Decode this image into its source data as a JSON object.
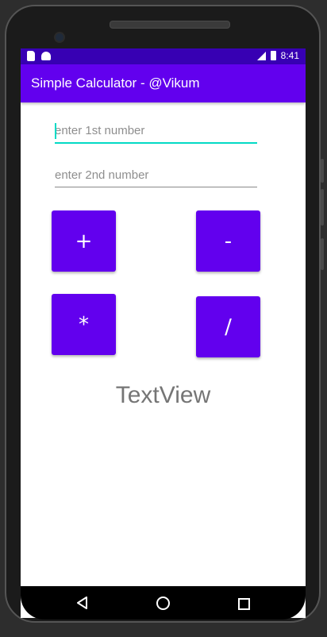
{
  "status_bar": {
    "time": "8:41",
    "icons": [
      "sd-card-icon",
      "android-icon",
      "signal-icon",
      "battery-icon"
    ]
  },
  "app_bar": {
    "title": "Simple Calculator - @Vikum"
  },
  "inputs": {
    "first": {
      "value": "",
      "placeholder": "enter 1st number"
    },
    "second": {
      "value": "",
      "placeholder": "enter 2nd number"
    }
  },
  "buttons": {
    "add": "+",
    "subtract": "-",
    "multiply": "*",
    "divide": "/"
  },
  "result": {
    "text": "TextView"
  },
  "nav_bar": {
    "icons": [
      "back-icon",
      "home-icon",
      "recents-icon"
    ]
  },
  "colors": {
    "status_bar": "#3700b3",
    "primary": "#6200ee",
    "accent": "#03dac5",
    "result_text": "#757575"
  }
}
